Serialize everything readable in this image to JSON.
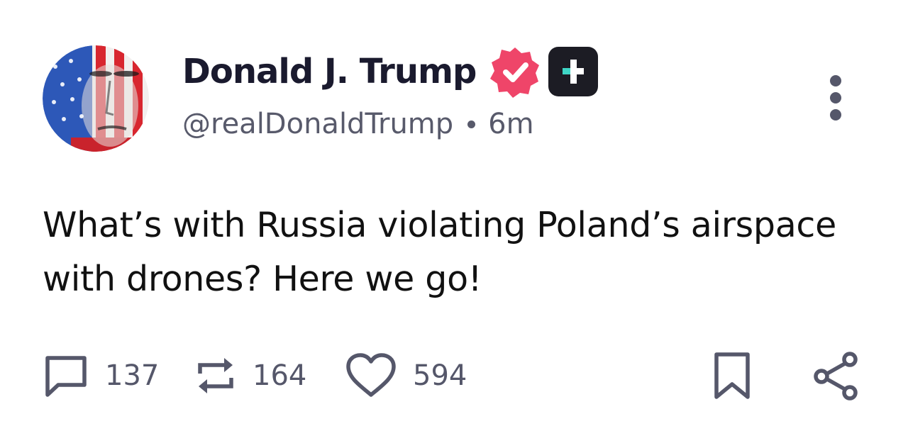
{
  "post": {
    "display_name": "Donald J. Trump",
    "handle": "@realDonaldTrump",
    "time_ago": "6m",
    "text": "What’s with Russia violating Poland’s airspace with drones? Here we go!",
    "icons": {
      "avatar": "flag-portrait-avatar",
      "verified": "verified-badge-icon",
      "plus": "plus-badge-icon",
      "more": "more-vertical-icon"
    },
    "colors": {
      "verified": "#ef4569",
      "plus_bg": "#1c1c24",
      "plus_accent": "#3fd6c6",
      "text": "#111111",
      "muted": "#585a6b"
    }
  },
  "actions": {
    "reply_count": "137",
    "repost_count": "164",
    "like_count": "594",
    "icons": [
      "reply-icon",
      "repost-icon",
      "like-icon",
      "bookmark-icon",
      "share-icon"
    ]
  }
}
